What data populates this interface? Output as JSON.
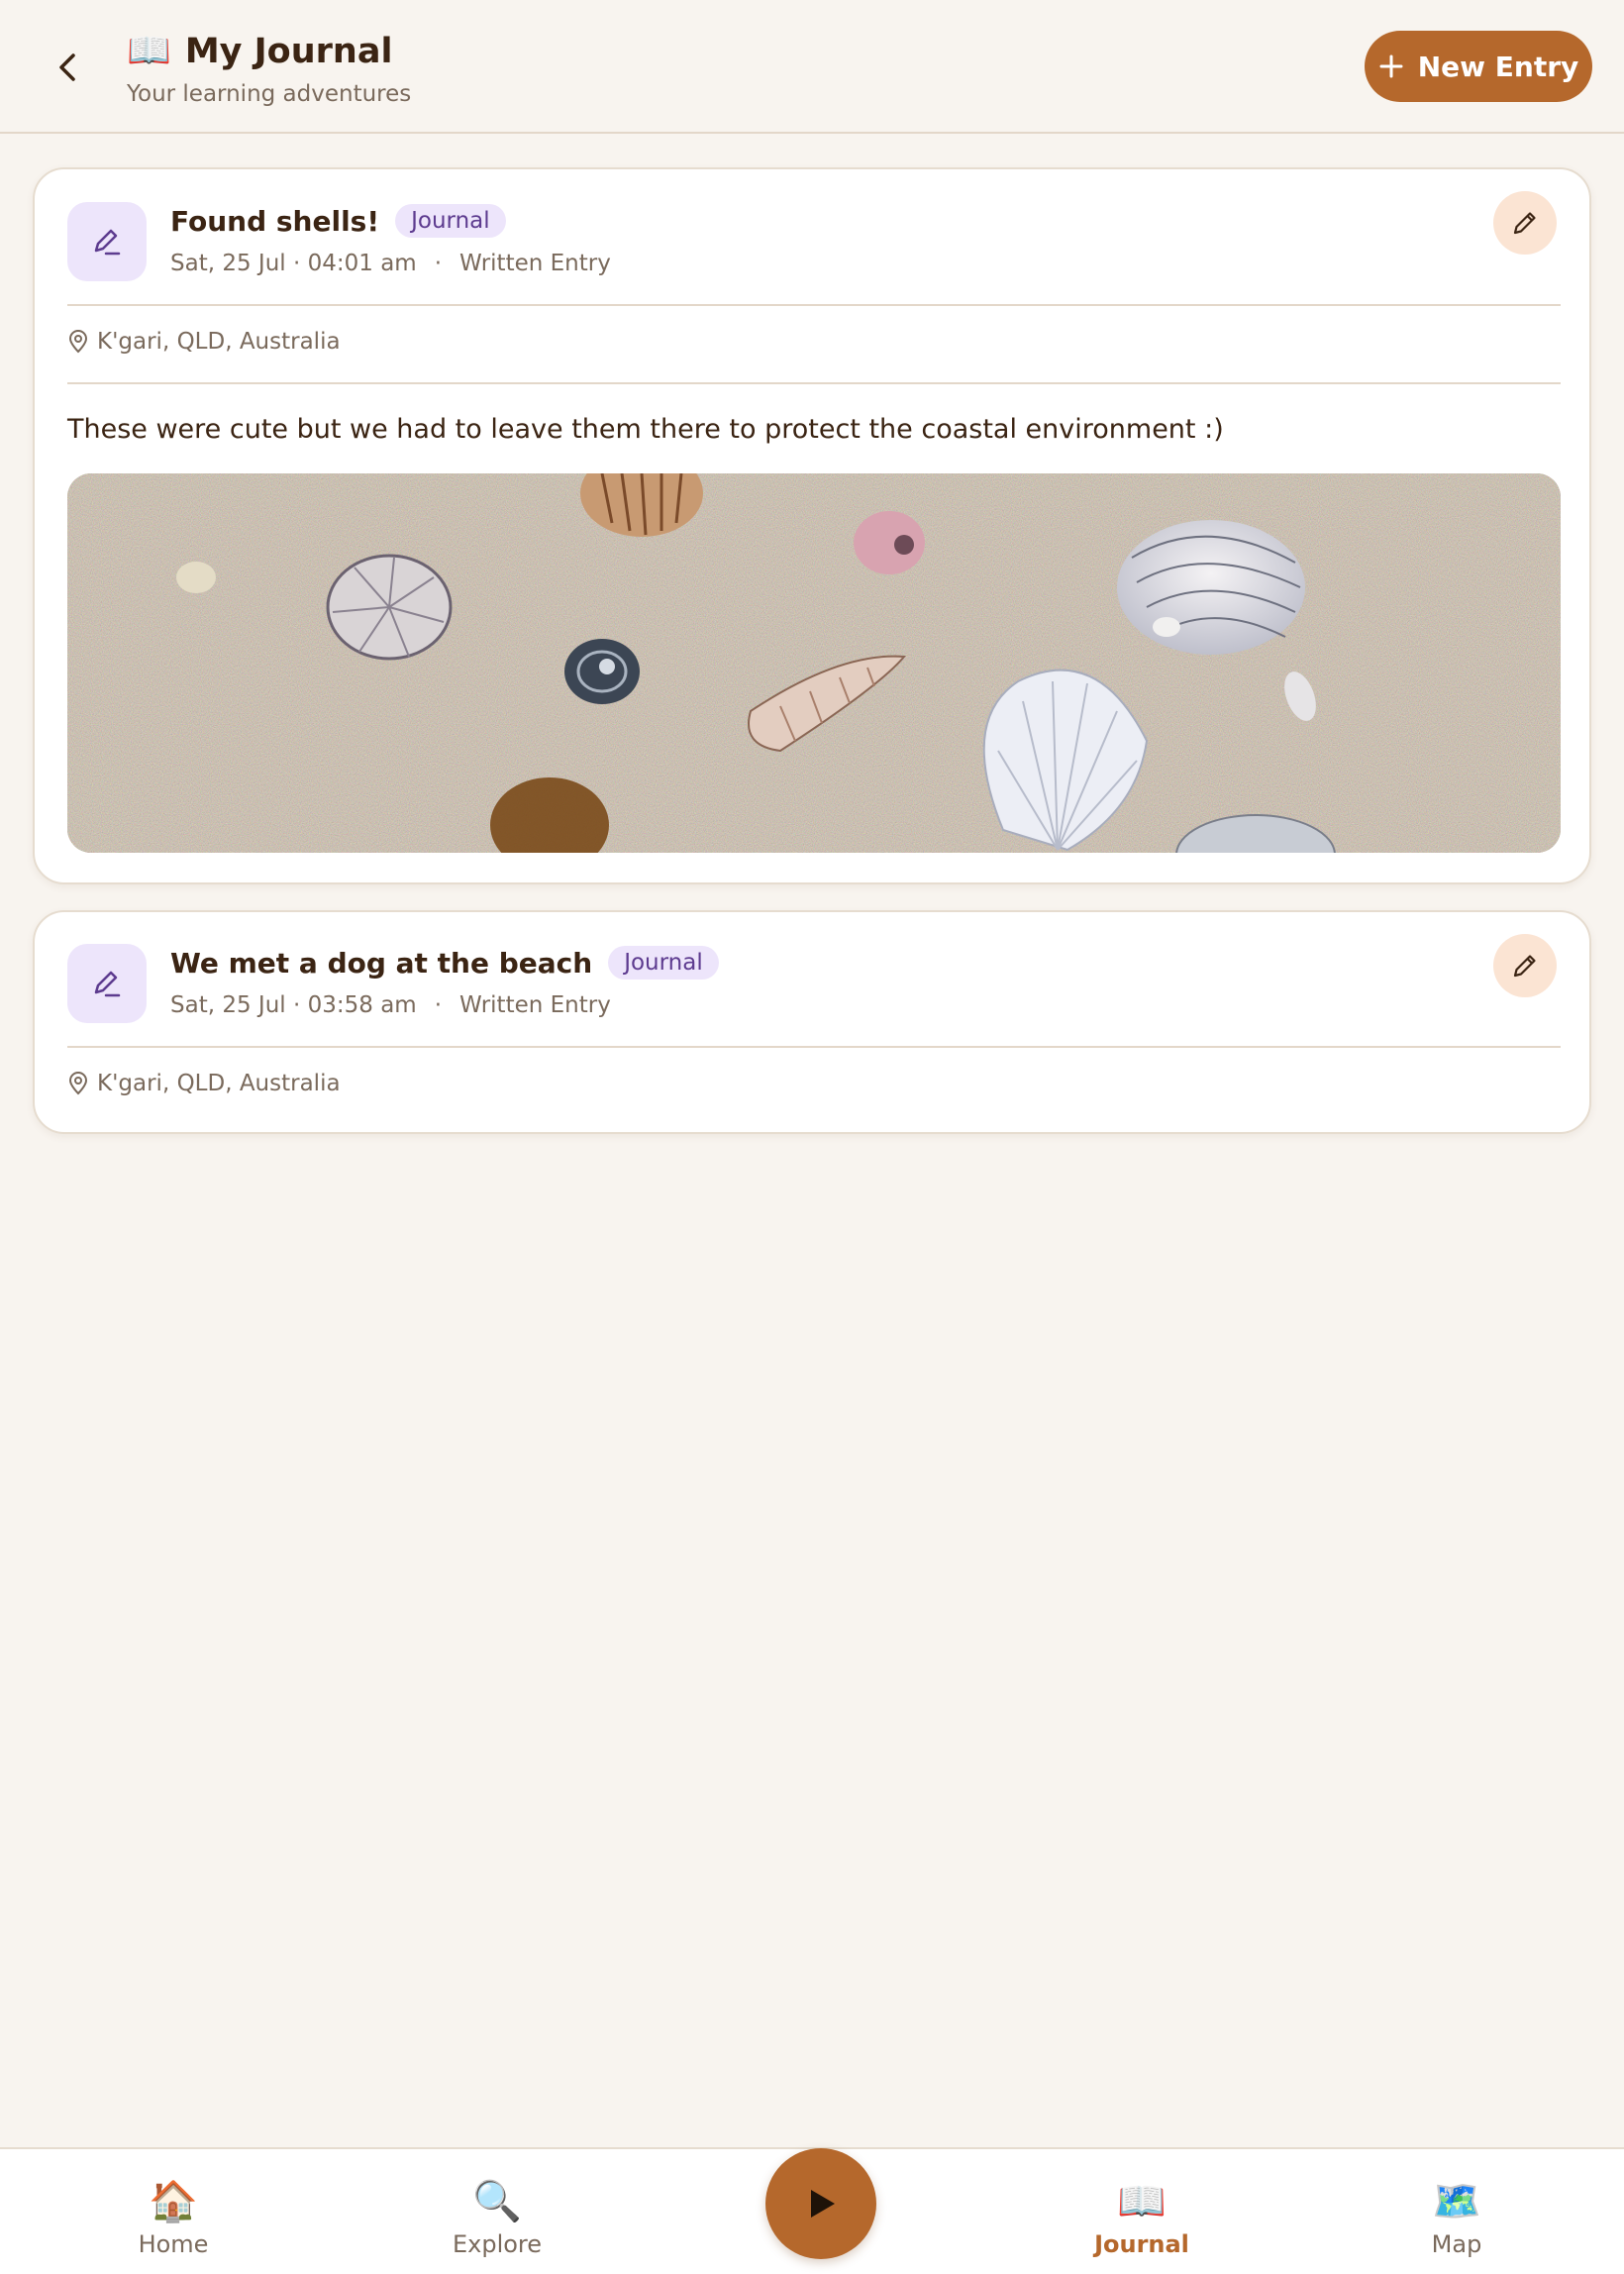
{
  "header": {
    "back_icon": "chevron-left-icon",
    "title_emoji": "📖",
    "title": "My Journal",
    "subtitle": "Your learning adventures",
    "new_entry_label": "New Entry"
  },
  "entries": [
    {
      "title": "Found shells!",
      "tag": "Journal",
      "date": "Sat, 25 Jul · 04:01 am",
      "separator": "·",
      "kind": "Written Entry",
      "location": "K'gari, QLD, Australia",
      "body": "These were cute but we had to leave them there to protect the coastal environment :)",
      "has_photo": true
    },
    {
      "title": "We met a dog at the beach",
      "tag": "Journal",
      "date": "Sat, 25 Jul · 03:58 am",
      "separator": "·",
      "kind": "Written Entry",
      "location": "K'gari, QLD, Australia",
      "has_photo": false
    }
  ],
  "nav": {
    "items": [
      {
        "label": "Home",
        "icon": "🏠"
      },
      {
        "label": "Explore",
        "icon": "🔍"
      },
      {
        "label": "Journal",
        "icon": "📖"
      },
      {
        "label": "Map",
        "icon": "🗺️"
      }
    ],
    "active": "Journal"
  },
  "colors": {
    "accent": "#b5682c",
    "background": "#f8f4ef",
    "tag_bg": "#ede5fb",
    "tag_text": "#5d3b8f",
    "edit_bg": "#fbe4d3"
  }
}
